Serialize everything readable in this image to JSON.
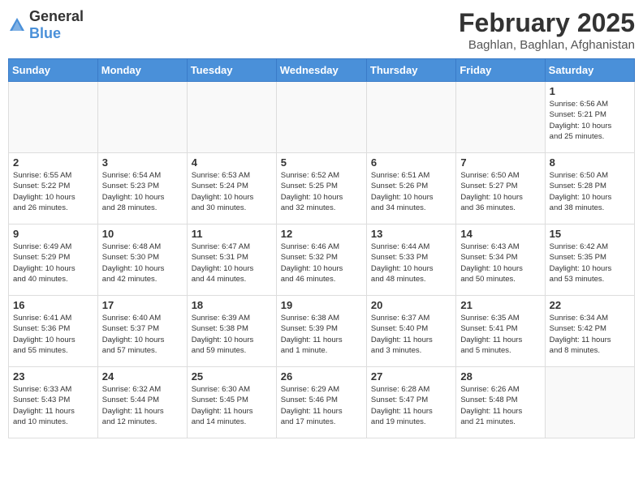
{
  "header": {
    "logo_general": "General",
    "logo_blue": "Blue",
    "main_title": "February 2025",
    "subtitle": "Baghlan, Baghlan, Afghanistan"
  },
  "calendar": {
    "days_of_week": [
      "Sunday",
      "Monday",
      "Tuesday",
      "Wednesday",
      "Thursday",
      "Friday",
      "Saturday"
    ],
    "weeks": [
      {
        "days": [
          {
            "num": "",
            "info": ""
          },
          {
            "num": "",
            "info": ""
          },
          {
            "num": "",
            "info": ""
          },
          {
            "num": "",
            "info": ""
          },
          {
            "num": "",
            "info": ""
          },
          {
            "num": "",
            "info": ""
          },
          {
            "num": "1",
            "info": "Sunrise: 6:56 AM\nSunset: 5:21 PM\nDaylight: 10 hours\nand 25 minutes."
          }
        ]
      },
      {
        "days": [
          {
            "num": "2",
            "info": "Sunrise: 6:55 AM\nSunset: 5:22 PM\nDaylight: 10 hours\nand 26 minutes."
          },
          {
            "num": "3",
            "info": "Sunrise: 6:54 AM\nSunset: 5:23 PM\nDaylight: 10 hours\nand 28 minutes."
          },
          {
            "num": "4",
            "info": "Sunrise: 6:53 AM\nSunset: 5:24 PM\nDaylight: 10 hours\nand 30 minutes."
          },
          {
            "num": "5",
            "info": "Sunrise: 6:52 AM\nSunset: 5:25 PM\nDaylight: 10 hours\nand 32 minutes."
          },
          {
            "num": "6",
            "info": "Sunrise: 6:51 AM\nSunset: 5:26 PM\nDaylight: 10 hours\nand 34 minutes."
          },
          {
            "num": "7",
            "info": "Sunrise: 6:50 AM\nSunset: 5:27 PM\nDaylight: 10 hours\nand 36 minutes."
          },
          {
            "num": "8",
            "info": "Sunrise: 6:50 AM\nSunset: 5:28 PM\nDaylight: 10 hours\nand 38 minutes."
          }
        ]
      },
      {
        "days": [
          {
            "num": "9",
            "info": "Sunrise: 6:49 AM\nSunset: 5:29 PM\nDaylight: 10 hours\nand 40 minutes."
          },
          {
            "num": "10",
            "info": "Sunrise: 6:48 AM\nSunset: 5:30 PM\nDaylight: 10 hours\nand 42 minutes."
          },
          {
            "num": "11",
            "info": "Sunrise: 6:47 AM\nSunset: 5:31 PM\nDaylight: 10 hours\nand 44 minutes."
          },
          {
            "num": "12",
            "info": "Sunrise: 6:46 AM\nSunset: 5:32 PM\nDaylight: 10 hours\nand 46 minutes."
          },
          {
            "num": "13",
            "info": "Sunrise: 6:44 AM\nSunset: 5:33 PM\nDaylight: 10 hours\nand 48 minutes."
          },
          {
            "num": "14",
            "info": "Sunrise: 6:43 AM\nSunset: 5:34 PM\nDaylight: 10 hours\nand 50 minutes."
          },
          {
            "num": "15",
            "info": "Sunrise: 6:42 AM\nSunset: 5:35 PM\nDaylight: 10 hours\nand 53 minutes."
          }
        ]
      },
      {
        "days": [
          {
            "num": "16",
            "info": "Sunrise: 6:41 AM\nSunset: 5:36 PM\nDaylight: 10 hours\nand 55 minutes."
          },
          {
            "num": "17",
            "info": "Sunrise: 6:40 AM\nSunset: 5:37 PM\nDaylight: 10 hours\nand 57 minutes."
          },
          {
            "num": "18",
            "info": "Sunrise: 6:39 AM\nSunset: 5:38 PM\nDaylight: 10 hours\nand 59 minutes."
          },
          {
            "num": "19",
            "info": "Sunrise: 6:38 AM\nSunset: 5:39 PM\nDaylight: 11 hours\nand 1 minute."
          },
          {
            "num": "20",
            "info": "Sunrise: 6:37 AM\nSunset: 5:40 PM\nDaylight: 11 hours\nand 3 minutes."
          },
          {
            "num": "21",
            "info": "Sunrise: 6:35 AM\nSunset: 5:41 PM\nDaylight: 11 hours\nand 5 minutes."
          },
          {
            "num": "22",
            "info": "Sunrise: 6:34 AM\nSunset: 5:42 PM\nDaylight: 11 hours\nand 8 minutes."
          }
        ]
      },
      {
        "days": [
          {
            "num": "23",
            "info": "Sunrise: 6:33 AM\nSunset: 5:43 PM\nDaylight: 11 hours\nand 10 minutes."
          },
          {
            "num": "24",
            "info": "Sunrise: 6:32 AM\nSunset: 5:44 PM\nDaylight: 11 hours\nand 12 minutes."
          },
          {
            "num": "25",
            "info": "Sunrise: 6:30 AM\nSunset: 5:45 PM\nDaylight: 11 hours\nand 14 minutes."
          },
          {
            "num": "26",
            "info": "Sunrise: 6:29 AM\nSunset: 5:46 PM\nDaylight: 11 hours\nand 17 minutes."
          },
          {
            "num": "27",
            "info": "Sunrise: 6:28 AM\nSunset: 5:47 PM\nDaylight: 11 hours\nand 19 minutes."
          },
          {
            "num": "28",
            "info": "Sunrise: 6:26 AM\nSunset: 5:48 PM\nDaylight: 11 hours\nand 21 minutes."
          },
          {
            "num": "",
            "info": ""
          }
        ]
      }
    ]
  }
}
